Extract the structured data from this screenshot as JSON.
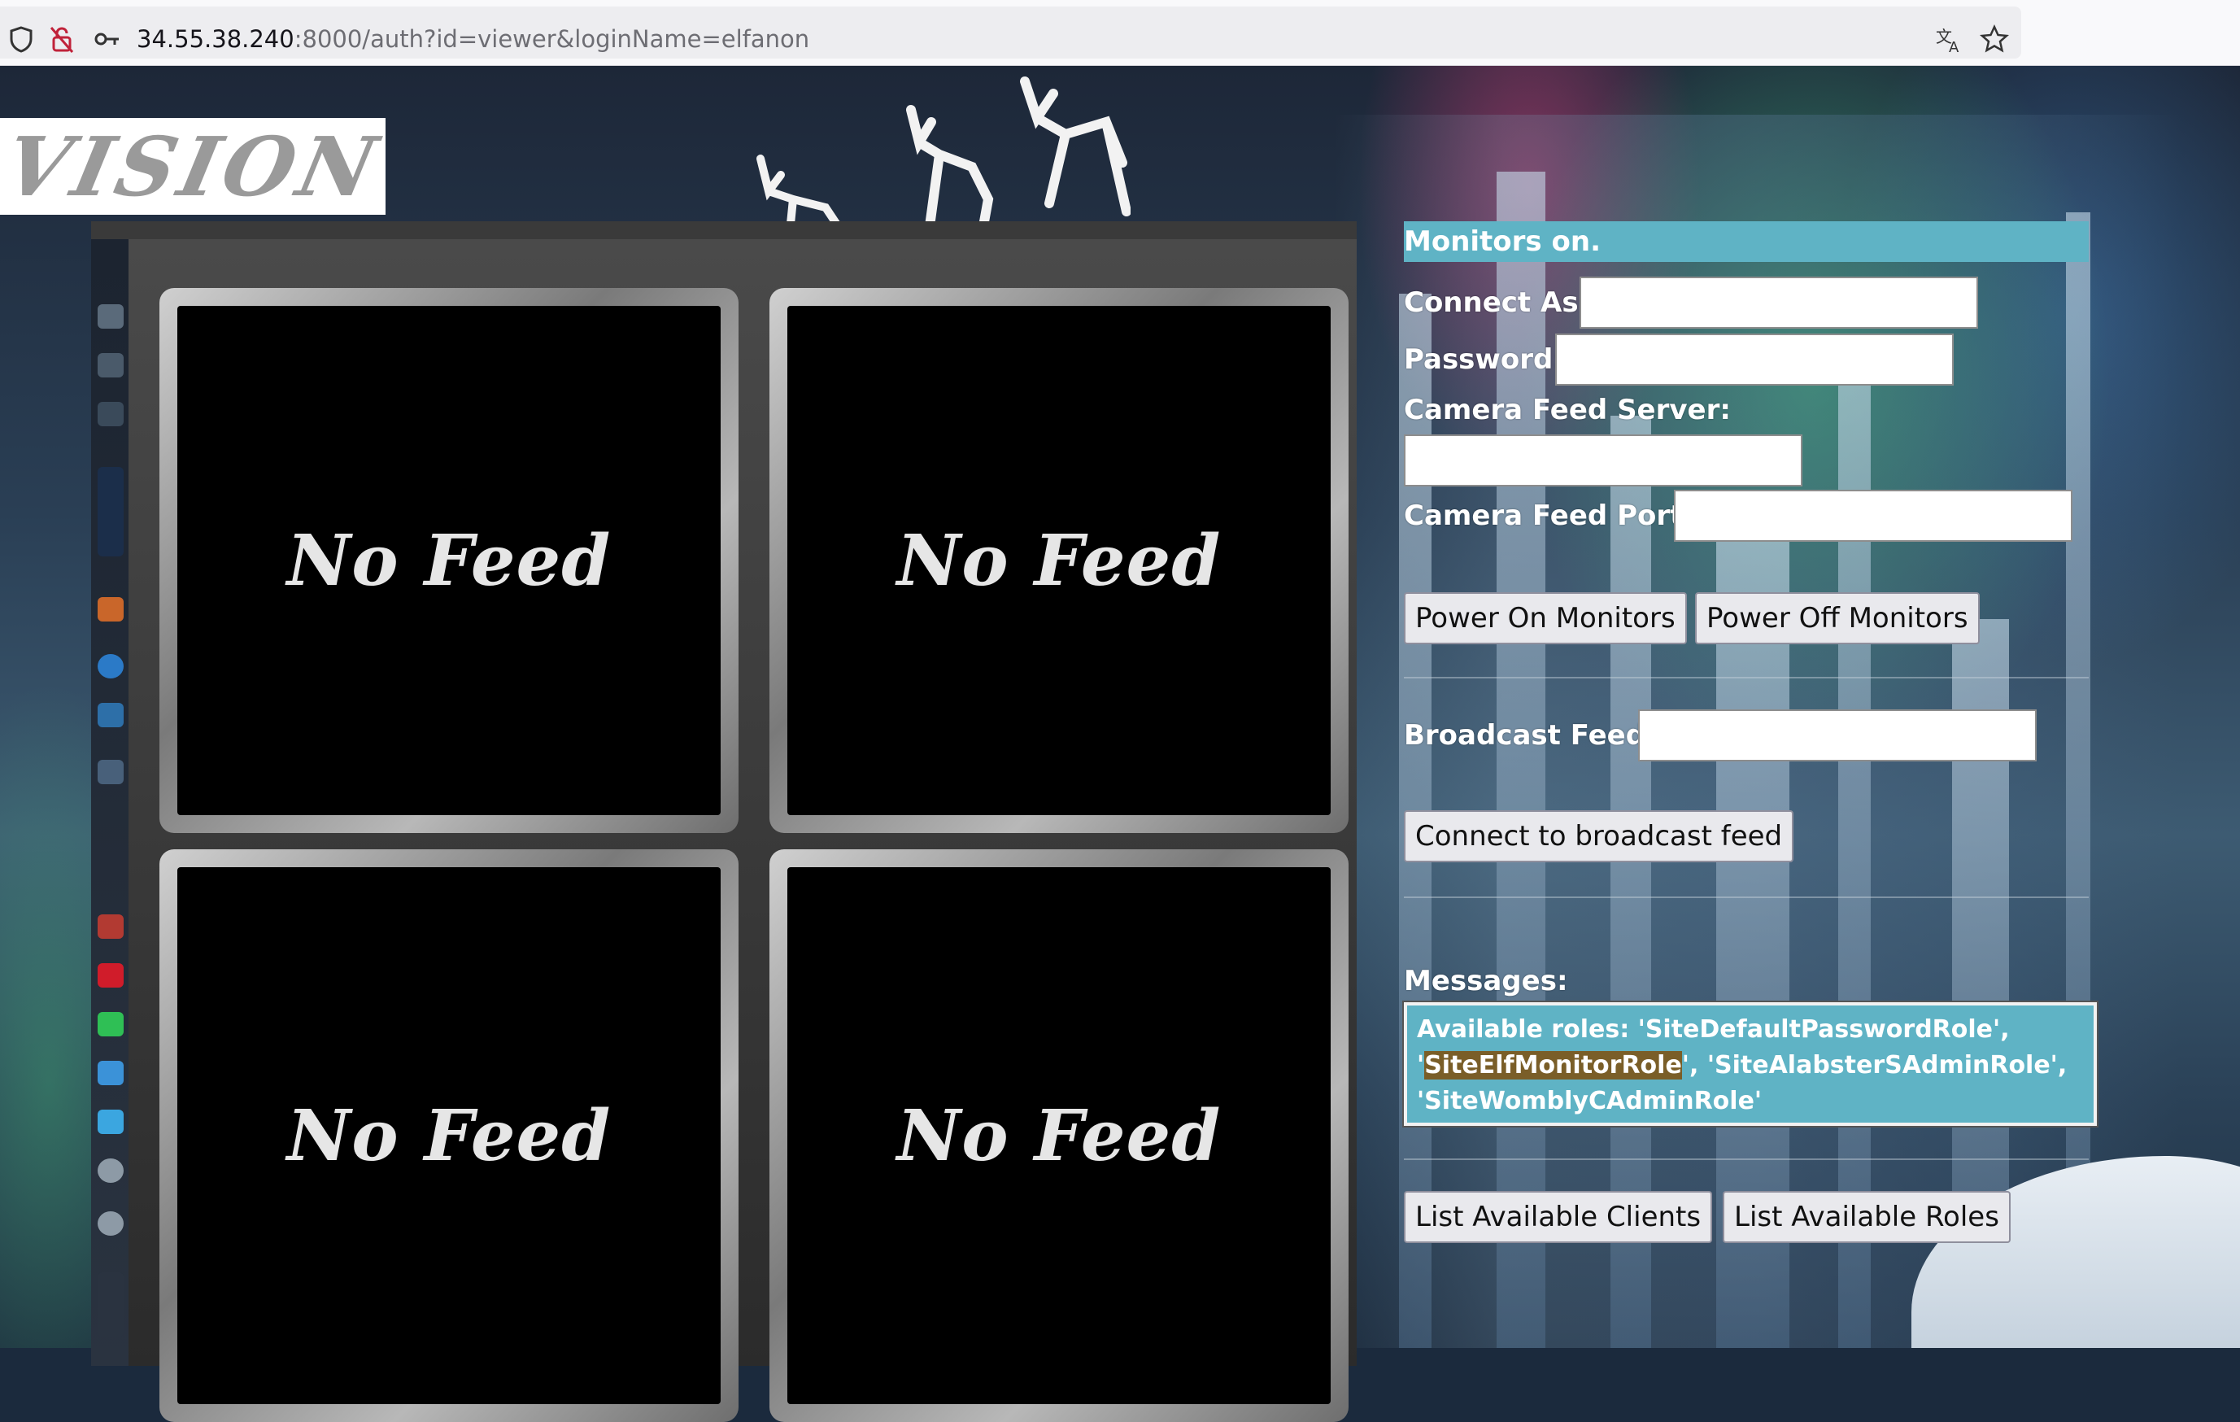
{
  "browser": {
    "url_host": "34.55.38.240",
    "url_rest": ":8000/auth?id=viewer&loginName=elfanon",
    "icons": [
      "shield-icon",
      "insecure-lock-icon",
      "key-icon",
      "translate-icon",
      "star-icon"
    ]
  },
  "logo": {
    "text": "VISION"
  },
  "monitors": {
    "feeds": [
      {
        "label": "No Feed"
      },
      {
        "label": "No Feed"
      },
      {
        "label": "No Feed"
      },
      {
        "label": "No Feed"
      }
    ]
  },
  "panel": {
    "status": "Monitors on.",
    "connect_as_label": "Connect As:",
    "connect_as_value": "",
    "password_label": "Password:",
    "password_value": "",
    "camera_feed_server_label": "Camera Feed Server:",
    "camera_feed_server_value": "",
    "camera_feed_port_label": "Camera Feed Port:",
    "camera_feed_port_value": "",
    "power_on_label": "Power On Monitors",
    "power_off_label": "Power Off Monitors",
    "broadcast_feed_label": "Broadcast Feed:",
    "broadcast_feed_value": "",
    "connect_broadcast_label": "Connect to broadcast feed",
    "messages_label": "Messages:",
    "messages": {
      "line1": "Available roles: 'SiteDefaultPasswordRole',",
      "line2_pre": "'",
      "line2_highlight": "SiteElfMonitorRole",
      "line2_post": "', 'SiteAlabsterSAdminRole',",
      "line3": "'SiteWomblyCAdminRole'"
    },
    "list_clients_label": "List Available Clients",
    "list_roles_label": "List Available Roles"
  },
  "colors": {
    "status_bar": "#5fb3c5",
    "messages_bg": "#5fb3c5",
    "highlight": "#7a5e28"
  }
}
